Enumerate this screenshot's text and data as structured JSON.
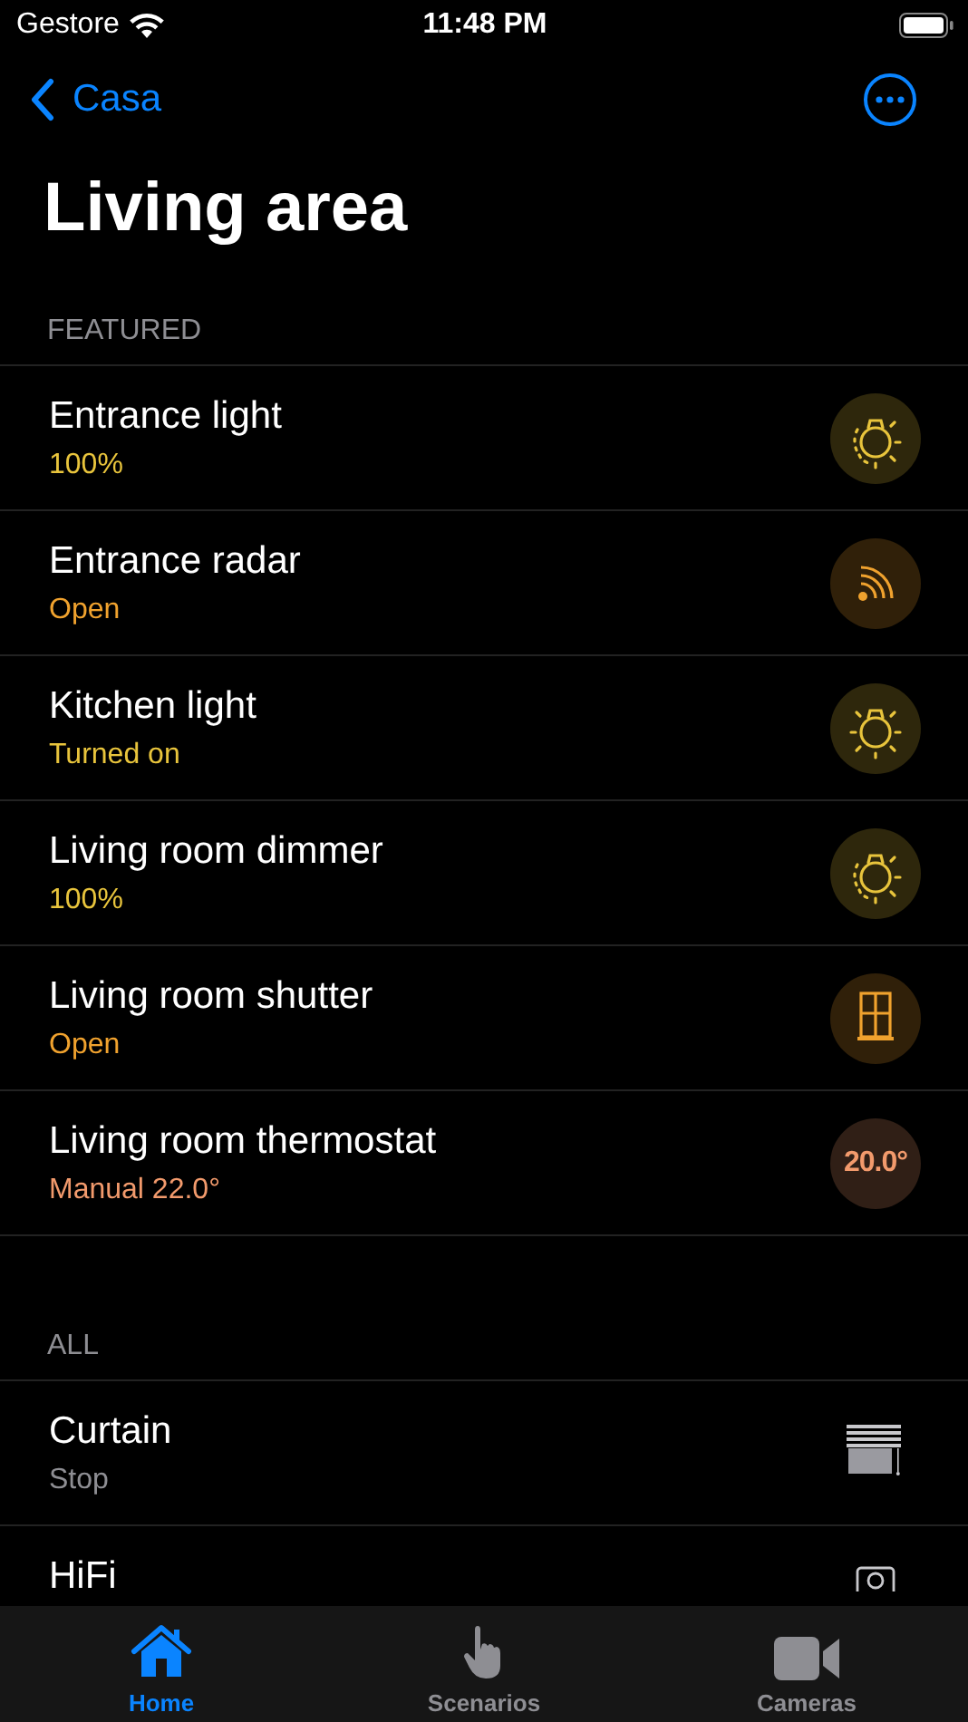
{
  "status_bar": {
    "carrier": "Gestore",
    "time": "11:48 PM"
  },
  "nav": {
    "back": "Casa"
  },
  "title": "Living area",
  "sections": [
    {
      "header": "FEATURED",
      "items": [
        {
          "name": "Entrance light",
          "status": "100%",
          "color": "#e8c43c",
          "kind": "dimmer"
        },
        {
          "name": "Entrance radar",
          "status": "Open",
          "color": "#f0a22e",
          "kind": "radar"
        },
        {
          "name": "Kitchen light",
          "status": "Turned on",
          "color": "#e8c43c",
          "kind": "bulb"
        },
        {
          "name": "Living room dimmer",
          "status": "100%",
          "color": "#e8c43c",
          "kind": "dimmer"
        },
        {
          "name": "Living room shutter",
          "status": "Open",
          "color": "#f0a22e",
          "kind": "shutter"
        },
        {
          "name": "Living room thermostat",
          "status": "Manual 22.0°",
          "color": "#f29a6c",
          "kind": "thermostat",
          "reading": "20.0°"
        }
      ]
    },
    {
      "header": "ALL",
      "items": [
        {
          "name": "Curtain",
          "status": "Stop",
          "color": "#8e8e93",
          "kind": "blinds"
        },
        {
          "name": "HiFi",
          "kind": "hifi"
        }
      ]
    }
  ],
  "tabs": [
    {
      "label": "Home",
      "selected": true,
      "kind": "home"
    },
    {
      "label": "Scenarios",
      "selected": false,
      "kind": "hand"
    },
    {
      "label": "Cameras",
      "selected": false,
      "kind": "camera"
    }
  ]
}
